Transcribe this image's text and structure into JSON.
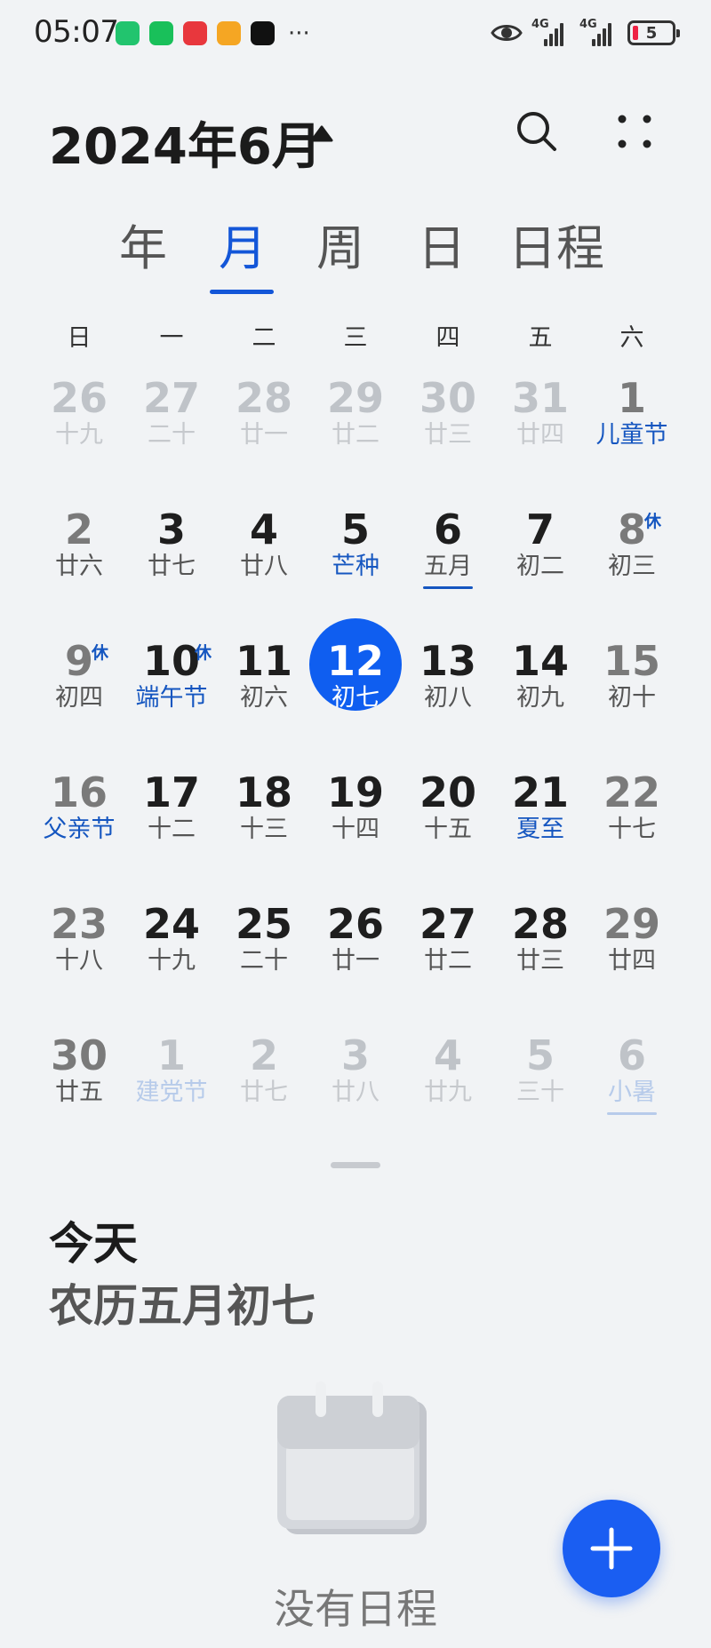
{
  "status_bar": {
    "time": "05:07",
    "network_1": "4G",
    "network_2": "4G",
    "battery_level": "5",
    "app_icons": [
      {
        "name": "timer-app-icon",
        "color": "#22c46e"
      },
      {
        "name": "wechat-app-icon",
        "color": "#19c05a"
      },
      {
        "name": "huawei-store-app-icon",
        "color": "#e8373d"
      },
      {
        "name": "orange-app-icon",
        "color": "#f5a623"
      },
      {
        "name": "dewu-app-icon",
        "color": "#111111"
      }
    ],
    "more": "···"
  },
  "header": {
    "title": "2024年6月"
  },
  "tabs": [
    {
      "id": "year",
      "label": "年",
      "active": false
    },
    {
      "id": "month",
      "label": "月",
      "active": true
    },
    {
      "id": "week",
      "label": "周",
      "active": false
    },
    {
      "id": "day",
      "label": "日",
      "active": false
    },
    {
      "id": "agenda",
      "label": "日程",
      "active": false
    }
  ],
  "weekdays": [
    "日",
    "一",
    "二",
    "三",
    "四",
    "五",
    "六"
  ],
  "weeks": [
    [
      {
        "day": "26",
        "lunar": "十九",
        "other": true
      },
      {
        "day": "27",
        "lunar": "二十",
        "other": true
      },
      {
        "day": "28",
        "lunar": "廿一",
        "other": true
      },
      {
        "day": "29",
        "lunar": "廿二",
        "other": true
      },
      {
        "day": "30",
        "lunar": "廿三",
        "other": true
      },
      {
        "day": "31",
        "lunar": "廿四",
        "other": true
      },
      {
        "day": "1",
        "lunar": "儿童节",
        "blue": true
      }
    ],
    [
      {
        "day": "2",
        "lunar": "廿六"
      },
      {
        "day": "3",
        "lunar": "廿七"
      },
      {
        "day": "4",
        "lunar": "廿八"
      },
      {
        "day": "5",
        "lunar": "芒种",
        "blue": true
      },
      {
        "day": "6",
        "lunar": "五月",
        "underline": true
      },
      {
        "day": "7",
        "lunar": "初二"
      },
      {
        "day": "8",
        "lunar": "初三",
        "badge": "休"
      }
    ],
    [
      {
        "day": "9",
        "lunar": "初四",
        "badge": "休"
      },
      {
        "day": "10",
        "lunar": "端午节",
        "blue": true,
        "badge": "休"
      },
      {
        "day": "11",
        "lunar": "初六"
      },
      {
        "day": "12",
        "lunar": "初七",
        "today": true
      },
      {
        "day": "13",
        "lunar": "初八"
      },
      {
        "day": "14",
        "lunar": "初九"
      },
      {
        "day": "15",
        "lunar": "初十"
      }
    ],
    [
      {
        "day": "16",
        "lunar": "父亲节",
        "blue": true
      },
      {
        "day": "17",
        "lunar": "十二"
      },
      {
        "day": "18",
        "lunar": "十三"
      },
      {
        "day": "19",
        "lunar": "十四"
      },
      {
        "day": "20",
        "lunar": "十五"
      },
      {
        "day": "21",
        "lunar": "夏至",
        "blue": true
      },
      {
        "day": "22",
        "lunar": "十七"
      }
    ],
    [
      {
        "day": "23",
        "lunar": "十八"
      },
      {
        "day": "24",
        "lunar": "十九"
      },
      {
        "day": "25",
        "lunar": "二十"
      },
      {
        "day": "26",
        "lunar": "廿一"
      },
      {
        "day": "27",
        "lunar": "廿二"
      },
      {
        "day": "28",
        "lunar": "廿三"
      },
      {
        "day": "29",
        "lunar": "廿四"
      }
    ],
    [
      {
        "day": "30",
        "lunar": "廿五"
      },
      {
        "day": "1",
        "lunar": "建党节",
        "blue": true,
        "other": true
      },
      {
        "day": "2",
        "lunar": "廿七",
        "other": true
      },
      {
        "day": "3",
        "lunar": "廿八",
        "other": true
      },
      {
        "day": "4",
        "lunar": "廿九",
        "other": true
      },
      {
        "day": "5",
        "lunar": "三十",
        "other": true
      },
      {
        "day": "6",
        "lunar": "小暑",
        "blue": true,
        "underline": true,
        "other": true
      }
    ]
  ],
  "today_section": {
    "label": "今天",
    "lunar_date": "农历五月初七",
    "empty_text": "没有日程"
  },
  "colors": {
    "accent": "#1356d8",
    "today_fill": "#0f5ef0",
    "festival_blue": "#1556c0",
    "background": "#f1f3f5"
  },
  "icons": {
    "title_caret": "caret-up-icon",
    "search": "search-icon",
    "menu": "more-dots-icon",
    "fab": "plus-icon",
    "empty": "calendar-illustration-icon"
  }
}
